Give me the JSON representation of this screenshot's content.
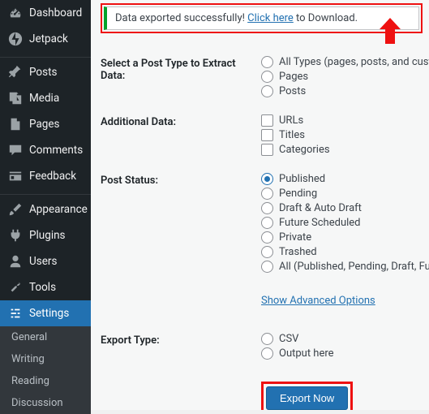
{
  "sidebar": {
    "items": [
      {
        "label": "Dashboard",
        "icon": "dashboard"
      },
      {
        "label": "Jetpack",
        "icon": "jetpack"
      },
      {
        "label": "Posts",
        "icon": "posts"
      },
      {
        "label": "Media",
        "icon": "media"
      },
      {
        "label": "Pages",
        "icon": "pages"
      },
      {
        "label": "Comments",
        "icon": "comments"
      },
      {
        "label": "Feedback",
        "icon": "feedback"
      },
      {
        "label": "Appearance",
        "icon": "appearance"
      },
      {
        "label": "Plugins",
        "icon": "plugins"
      },
      {
        "label": "Users",
        "icon": "users"
      },
      {
        "label": "Tools",
        "icon": "tools"
      },
      {
        "label": "Settings",
        "icon": "settings",
        "active": true
      }
    ],
    "submenu": [
      "General",
      "Writing",
      "Reading",
      "Discussion"
    ]
  },
  "notice": {
    "before": "Data exported successfully! ",
    "link": "Click here",
    "after": " to Download."
  },
  "form": {
    "postType": {
      "label": "Select a Post Type to Extract Data:",
      "options": [
        "All Types (pages, posts, and custom po",
        "Pages",
        "Posts"
      ]
    },
    "additional": {
      "label": "Additional Data:",
      "options": [
        "URLs",
        "Titles",
        "Categories"
      ]
    },
    "status": {
      "label": "Post Status:",
      "options": [
        "Published",
        "Pending",
        "Draft & Auto Draft",
        "Future Scheduled",
        "Private",
        "Trashed",
        "All (Published, Pending, Draft, Future S"
      ],
      "selected": 0
    },
    "advanced": "Show Advanced Options",
    "exportType": {
      "label": "Export Type:",
      "options": [
        "CSV",
        "Output here"
      ]
    },
    "button": "Export Now"
  }
}
